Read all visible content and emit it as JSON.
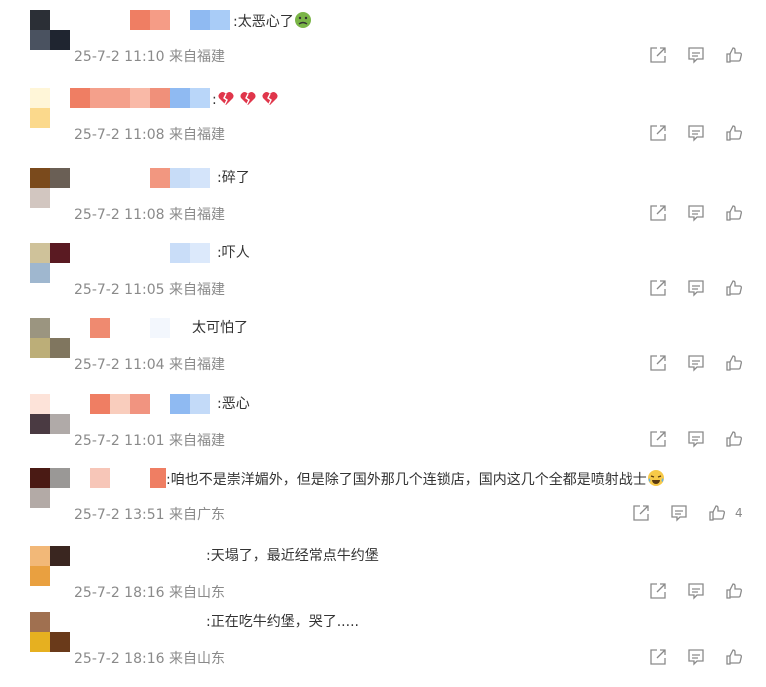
{
  "comments": [
    {
      "text": ":太恶心了",
      "emoji": "nauseated-face-icon",
      "time": "25-7-2 11:10",
      "location": "来自福建",
      "likes": ""
    },
    {
      "text": ":",
      "emoji": "broken-heart-icon",
      "time": "25-7-2 11:08",
      "location": "来自福建",
      "likes": ""
    },
    {
      "text": ":碎了",
      "time": "25-7-2 11:08",
      "location": "来自福建",
      "likes": ""
    },
    {
      "text": ":吓人",
      "time": "25-7-2 11:05",
      "location": "来自福建",
      "likes": ""
    },
    {
      "text": "太可怕了",
      "time": "25-7-2 11:04",
      "location": "来自福建",
      "likes": ""
    },
    {
      "text": ":恶心",
      "time": "25-7-2 11:01",
      "location": "来自福建",
      "likes": ""
    },
    {
      "text": ":咱也不是崇洋媚外，但是除了国外那几个连锁店，国内这几个全都是喷射战士",
      "emoji": "laughing-tears-icon",
      "time": "25-7-2 13:51",
      "location": "来自广东",
      "likes": "4"
    },
    {
      "text": ":天塌了，最近经常点牛约堡",
      "time": "25-7-2 18:16",
      "location": "来自山东",
      "likes": ""
    },
    {
      "text": ":正在吃牛约堡，哭了.....",
      "time": "25-7-2 18:16",
      "location": "来自山东",
      "likes": ""
    }
  ],
  "icons": {
    "share": "share-icon",
    "reply": "comment-icon",
    "like": "thumbs-up-icon"
  },
  "colors": {
    "text": "#333333",
    "meta": "#8a8a8a",
    "icon": "#8a8a8a"
  }
}
